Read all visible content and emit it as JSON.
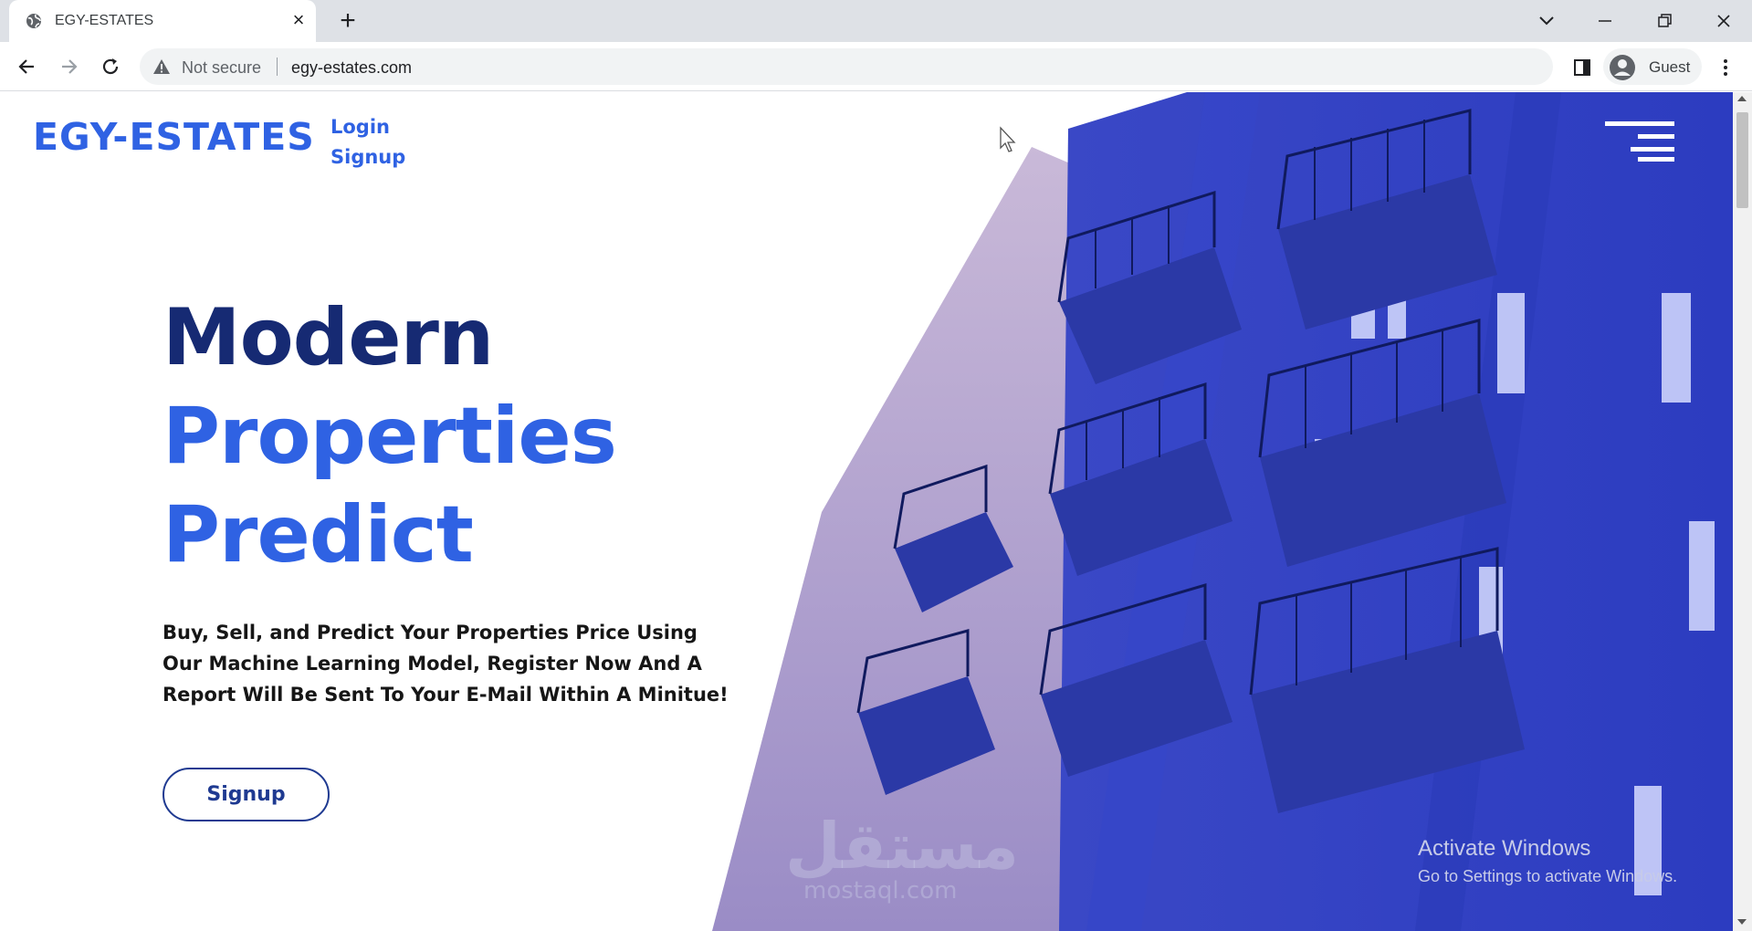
{
  "browser": {
    "tab_title": "EGY-ESTATES",
    "tab_favicon": "globe-icon",
    "security_label": "Not secure",
    "url": "egy-estates.com",
    "profile_name": "Guest"
  },
  "site": {
    "logo": "EGY-ESTATES",
    "nav": {
      "login": "Login",
      "signup": "Signup"
    },
    "hero": {
      "line1": "Modern",
      "line2": "Properties",
      "line3": "Predict",
      "description": "Buy, Sell, and Predict Your Properties Price Using Our Machine Learning Model, Register Now And A Report Will Be Sent To Your E-Mail Within A Minitue!",
      "cta": "Signup"
    }
  },
  "os": {
    "activate_title": "Activate Windows",
    "activate_sub": "Go to Settings to activate Windows."
  },
  "watermark": {
    "arabic": "مستقل",
    "latin": "mostaql.com"
  },
  "colors": {
    "brand_blue": "#2f62e3",
    "navy": "#162a73",
    "overlay_blue": "#2f3fc4",
    "text_dark": "#161616"
  }
}
